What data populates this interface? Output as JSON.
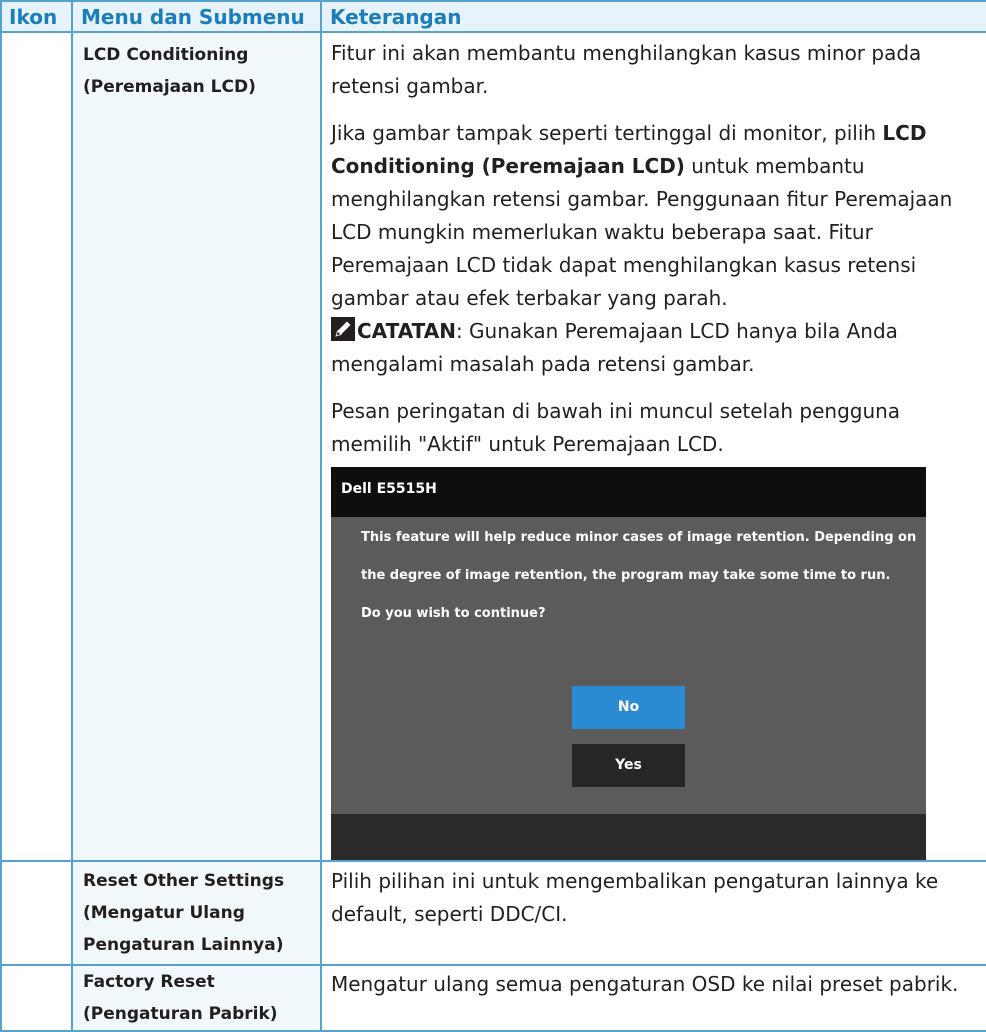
{
  "header": {
    "col1": "Ikon",
    "col2": "Menu dan Submenu",
    "col3": "Keterangan"
  },
  "rows": [
    {
      "menu_line1": "LCD Conditioning",
      "menu_line2": "(Peremajaan LCD)",
      "p1": "Fitur ini akan membantu menghilangkan kasus minor pada retensi gambar.",
      "p2_pre": "Jika gambar tampak seperti tertinggal di monitor, pilih ",
      "p2_bold": "LCD Conditioning (Peremajaan LCD)",
      "p2_post": " untuk membantu menghilangkan retensi gambar. Penggunaan fitur Peremajaan LCD mungkin memerlukan waktu beberapa saat. Fitur Peremajaan LCD tidak dapat menghilangkan kasus retensi gambar atau efek terbakar yang parah.",
      "note_label": "CATATAN",
      "note_text": ": Gunakan Peremajaan LCD hanya bila Anda mengalami masalah pada retensi gambar.",
      "p3": "Pesan peringatan di bawah ini muncul setelah pengguna memilih \"Aktif\" untuk Peremajaan LCD."
    },
    {
      "menu_line1": "Reset Other Settings",
      "menu_line2": "(Mengatur Ulang",
      "menu_line3": "Pengaturan Lainnya)",
      "desc": "Pilih pilihan ini untuk mengembalikan pengaturan lainnya ke default, seperti DDC/CI."
    },
    {
      "menu_line1": "Factory Reset",
      "menu_line2": "(Pengaturan Pabrik)",
      "desc": "Mengatur ulang semua pengaturan OSD ke nilai preset pabrik."
    }
  ],
  "dialog": {
    "title": "Dell E5515H",
    "line1": "This feature will help reduce minor cases of image retention. Depending on",
    "line2": "the degree of image retention, the program may take some time to run.",
    "line3": "Do you wish to continue?",
    "btn_no": "No",
    "btn_yes": "Yes",
    "icon": "pencil-note-icon"
  },
  "colors": {
    "border": "#55a3cf",
    "header_bg": "#e7f3fb",
    "header_text": "#1b7db9",
    "menu_bg": "#f1f8fc",
    "no_button": "#2a8ad2"
  }
}
